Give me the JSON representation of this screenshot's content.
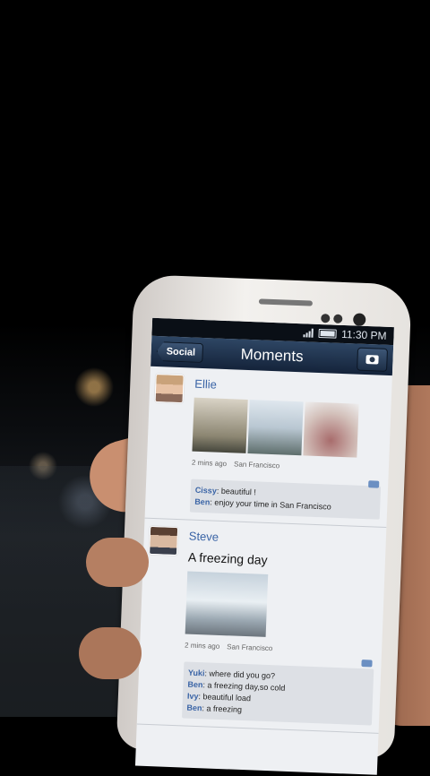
{
  "status": {
    "time": "11:30 PM"
  },
  "nav": {
    "back_label": "Social",
    "title": "Moments"
  },
  "posts": [
    {
      "name": "Ellie",
      "text": "",
      "time_ago": "2 mins ago",
      "location": "San Francisco",
      "comments": [
        {
          "author": "Cissy",
          "text": "beautiful !"
        },
        {
          "author": "Ben",
          "text": "enjoy your time in San Francisco"
        }
      ]
    },
    {
      "name": "Steve",
      "text": "A freezing day",
      "time_ago": "2 mins ago",
      "location": "San Francisco",
      "comments": [
        {
          "author": "Yuki",
          "text": "where did you go?"
        },
        {
          "author": "Ben",
          "text": "a freezing day,so cold"
        },
        {
          "author": "Ivy",
          "text": "beautiful load"
        },
        {
          "author": "Ben",
          "text": "a freezing"
        }
      ]
    }
  ]
}
